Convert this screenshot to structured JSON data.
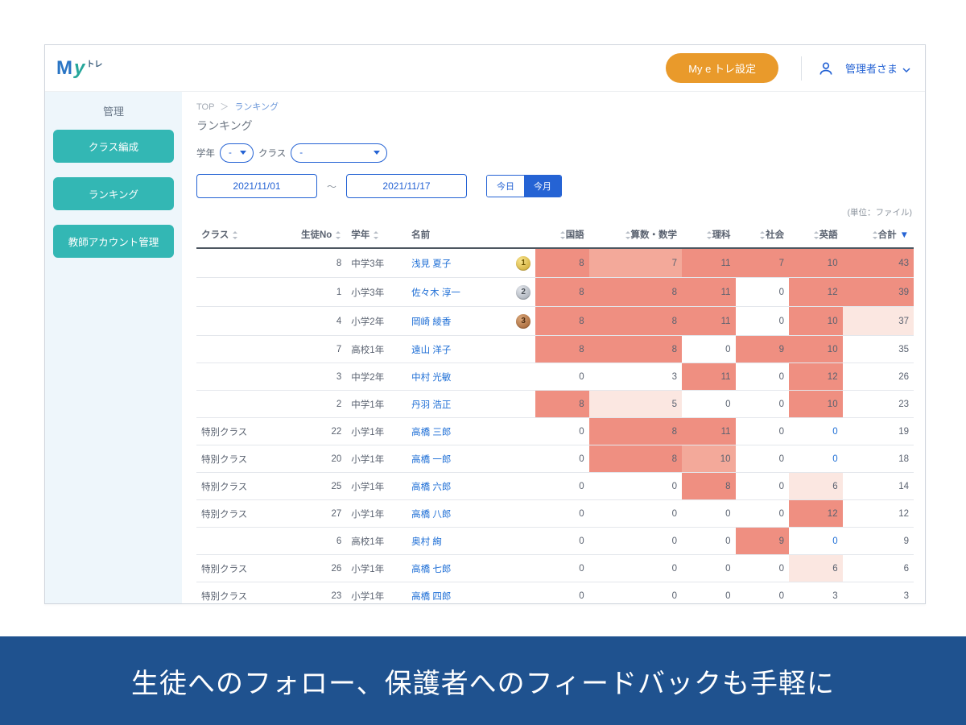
{
  "header": {
    "logo_m": "M",
    "logo_y": "y",
    "logo_tr": "トレ",
    "settings_label": "My e トレ設定",
    "user_label": "管理者さま"
  },
  "sidebar": {
    "title": "管理",
    "items": [
      {
        "label": "クラス編成"
      },
      {
        "label": "ランキング"
      },
      {
        "label": "教師アカウント管理"
      }
    ]
  },
  "breadcrumb": {
    "top": "TOP",
    "current": "ランキング"
  },
  "page_title": "ランキング",
  "filters": {
    "grade_label": "学年",
    "class_label": "クラス",
    "grade_value": "-",
    "class_value": "-",
    "date_from": "2021/11/01",
    "date_to": "2021/11/17",
    "seg_today": "今日",
    "seg_month": "今月"
  },
  "unit_note": "(単位：ファイル)",
  "columns": {
    "class": "クラス",
    "student_no": "生徒No",
    "grade": "学年",
    "name": "名前",
    "kokugo": "国語",
    "sansu": "算数・数学",
    "rika": "理科",
    "shakai": "社会",
    "eigo": "英語",
    "total": "合計"
  },
  "rows": [
    {
      "class": "",
      "no": 8,
      "grade": "中学3年",
      "name": "浅見 夏子",
      "medal": 1,
      "k": [
        8,
        4
      ],
      "s": [
        7,
        3
      ],
      "r": [
        11,
        4
      ],
      "sh": [
        7,
        4
      ],
      "e": [
        10,
        4
      ],
      "t": [
        43,
        4
      ]
    },
    {
      "class": "",
      "no": 1,
      "grade": "小学3年",
      "name": "佐々木 淳一",
      "medal": 2,
      "k": [
        8,
        4
      ],
      "s": [
        8,
        4
      ],
      "r": [
        11,
        4
      ],
      "sh": [
        0,
        0
      ],
      "e": [
        12,
        4
      ],
      "t": [
        39,
        4
      ]
    },
    {
      "class": "",
      "no": 4,
      "grade": "小学2年",
      "name": "岡崎 綾香",
      "medal": 3,
      "k": [
        8,
        4
      ],
      "s": [
        8,
        4
      ],
      "r": [
        11,
        4
      ],
      "sh": [
        0,
        0
      ],
      "e": [
        10,
        4
      ],
      "t": [
        37,
        1
      ]
    },
    {
      "class": "",
      "no": 7,
      "grade": "高校1年",
      "name": "遠山 洋子",
      "medal": 0,
      "k": [
        8,
        4
      ],
      "s": [
        8,
        4
      ],
      "r": [
        0,
        0
      ],
      "sh": [
        9,
        4
      ],
      "e": [
        10,
        4
      ],
      "t": [
        35,
        0
      ]
    },
    {
      "class": "",
      "no": 3,
      "grade": "中学2年",
      "name": "中村 光敏",
      "medal": 0,
      "k": [
        0,
        0
      ],
      "s": [
        3,
        0
      ],
      "r": [
        11,
        4
      ],
      "sh": [
        0,
        0
      ],
      "e": [
        12,
        4
      ],
      "t": [
        26,
        0
      ]
    },
    {
      "class": "",
      "no": 2,
      "grade": "中学1年",
      "name": "丹羽 浩正",
      "medal": 0,
      "k": [
        8,
        4
      ],
      "s": [
        5,
        1
      ],
      "r": [
        0,
        0
      ],
      "sh": [
        0,
        0
      ],
      "e": [
        10,
        4
      ],
      "t": [
        23,
        0
      ]
    },
    {
      "class": "特別クラス",
      "no": 22,
      "grade": "小学1年",
      "name": "高橋 三郎",
      "medal": 0,
      "k": [
        0,
        0
      ],
      "s": [
        8,
        4
      ],
      "r": [
        11,
        4
      ],
      "sh": [
        0,
        0
      ],
      "e": [
        0,
        0
      ],
      "elink": true,
      "t": [
        19,
        0
      ]
    },
    {
      "class": "特別クラス",
      "no": 20,
      "grade": "小学1年",
      "name": "高橋 一郎",
      "medal": 0,
      "k": [
        0,
        0
      ],
      "s": [
        8,
        4
      ],
      "r": [
        10,
        3
      ],
      "sh": [
        0,
        0
      ],
      "e": [
        0,
        0
      ],
      "elink": true,
      "t": [
        18,
        0
      ]
    },
    {
      "class": "特別クラス",
      "no": 25,
      "grade": "小学1年",
      "name": "高橋 六郎",
      "medal": 0,
      "k": [
        0,
        0
      ],
      "s": [
        0,
        0
      ],
      "r": [
        8,
        4
      ],
      "sh": [
        0,
        0
      ],
      "e": [
        6,
        1
      ],
      "t": [
        14,
        0
      ]
    },
    {
      "class": "特別クラス",
      "no": 27,
      "grade": "小学1年",
      "name": "高橋 八郎",
      "medal": 0,
      "k": [
        0,
        0
      ],
      "s": [
        0,
        0
      ],
      "r": [
        0,
        0
      ],
      "sh": [
        0,
        0
      ],
      "e": [
        12,
        4
      ],
      "t": [
        12,
        0
      ]
    },
    {
      "class": "",
      "no": 6,
      "grade": "高校1年",
      "name": "奥村 絢",
      "medal": 0,
      "k": [
        0,
        0
      ],
      "s": [
        0,
        0
      ],
      "r": [
        0,
        0
      ],
      "sh": [
        9,
        4
      ],
      "e": [
        0,
        0
      ],
      "elink": true,
      "t": [
        9,
        0
      ]
    },
    {
      "class": "特別クラス",
      "no": 26,
      "grade": "小学1年",
      "name": "高橋 七郎",
      "medal": 0,
      "k": [
        0,
        0
      ],
      "s": [
        0,
        0
      ],
      "r": [
        0,
        0
      ],
      "sh": [
        0,
        0
      ],
      "e": [
        6,
        1
      ],
      "t": [
        6,
        0
      ]
    },
    {
      "class": "特別クラス",
      "no": 23,
      "grade": "小学1年",
      "name": "高橋 四郎",
      "medal": 0,
      "k": [
        0,
        0
      ],
      "s": [
        0,
        0
      ],
      "r": [
        0,
        0
      ],
      "sh": [
        0,
        0
      ],
      "e": [
        3,
        0
      ],
      "t": [
        3,
        0
      ]
    }
  ],
  "banner": "生徒へのフォロー、保護者へのフィードバックも手軽に"
}
